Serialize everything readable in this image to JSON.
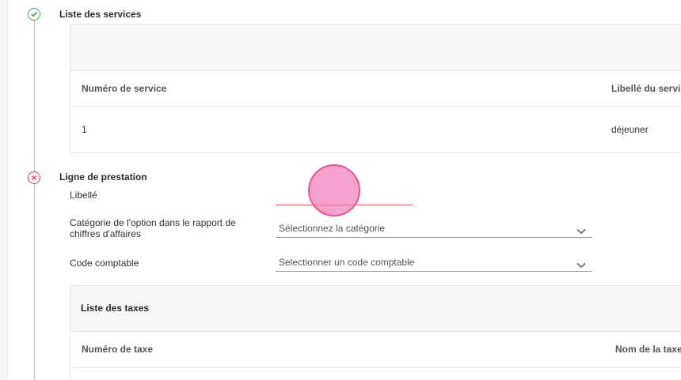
{
  "steps": {
    "services": {
      "title": "Liste des services",
      "columns": [
        "Numéro de service",
        "Libellé du servi"
      ],
      "rows": [
        {
          "number": "1",
          "label": "déjeuner"
        }
      ]
    },
    "prestation": {
      "title": "Ligne de prestation",
      "fields": {
        "libelle_label": "Libellé",
        "libelle_value": "",
        "category_label": "Catégorie de l'option dans le rapport de chiffres d'affaires",
        "category_placeholder": "Sélectionnez la catégorie",
        "code_label": "Code comptable",
        "code_placeholder": "Selectionner un code comptable"
      },
      "taxes": {
        "title": "Liste des taxes",
        "columns": [
          "Numéro de taxe",
          "Nom de la taxe"
        ]
      }
    }
  },
  "colors": {
    "success": "#3ea84a",
    "error": "#d9414b",
    "touch_marker": "#f382ba"
  },
  "icons": {
    "services_status": "check-circle-icon",
    "prestation_status": "error-circle-icon",
    "select_chevron": "chevron-down-icon"
  }
}
